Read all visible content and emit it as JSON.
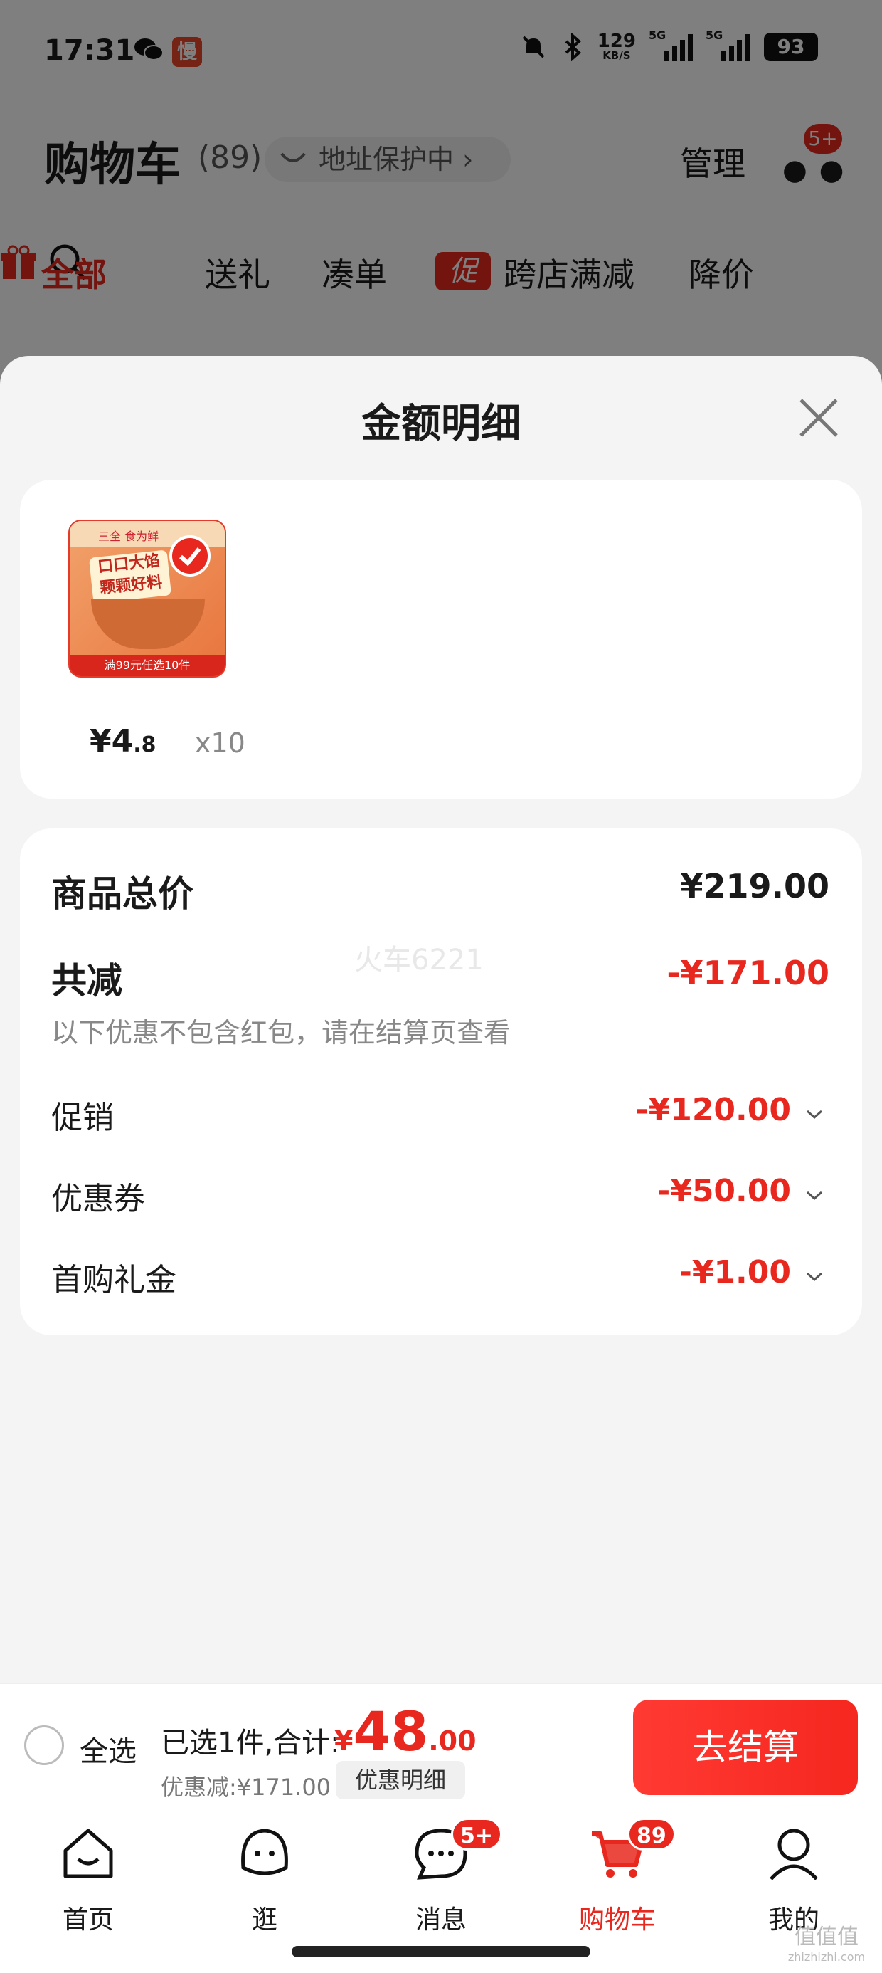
{
  "status_bar": {
    "time": "17:31",
    "slow_badge": "慢",
    "net_speed": "129",
    "net_unit": "KB/S",
    "signal1_label": "5G",
    "signal2_label": "5G",
    "battery": "93"
  },
  "cart_header": {
    "title": "购物车",
    "count": "(89)",
    "address_protect": "地址保护中 ›",
    "manage": "管理",
    "more_badge": "5+"
  },
  "filters": {
    "all": "全部",
    "gift": "送礼",
    "coudan": "凑单",
    "promo_icon": "促",
    "cross_store": "跨店满减",
    "price_drop": "降价"
  },
  "sheet": {
    "title": "金额明细",
    "item": {
      "thumb_top": "三全 食为鲜",
      "thumb_label": "口口大馅 颗颗好料",
      "thumb_bar": "满99元任选10件",
      "price_int": "¥4",
      "price_dec": ".8",
      "qty": "x10"
    },
    "watermark": "火车6221",
    "total_label": "商品总价",
    "total_value": "¥219.00",
    "reduce_label": "共减",
    "reduce_value": "-¥171.00",
    "reduce_note": "以下优惠不包含红包，请在结算页查看",
    "rows": [
      {
        "label": "促销",
        "value": "-¥120.00"
      },
      {
        "label": "优惠券",
        "value": "-¥50.00"
      },
      {
        "label": "首购礼金",
        "value": "-¥1.00"
      }
    ]
  },
  "checkout": {
    "select_all": "全选",
    "selected_text": "已选1件,合计:",
    "total_yen": "¥",
    "total_int": "48",
    "total_dec": ".00",
    "discount_text": "优惠减:¥171.00",
    "discount_detail_btn": "优惠明细",
    "pay_btn": "去结算"
  },
  "tabbar": {
    "tabs": [
      {
        "label": "首页",
        "badge": ""
      },
      {
        "label": "逛",
        "badge": ""
      },
      {
        "label": "消息",
        "badge": "5+"
      },
      {
        "label": "购物车",
        "badge": "89"
      },
      {
        "label": "我的",
        "badge": ""
      }
    ]
  },
  "corner_mark": {
    "text": "值值值",
    "sub": "zhizhizhi.com"
  },
  "colors": {
    "accent": "#e8281e",
    "sheet_bg": "#f4f4f4"
  }
}
